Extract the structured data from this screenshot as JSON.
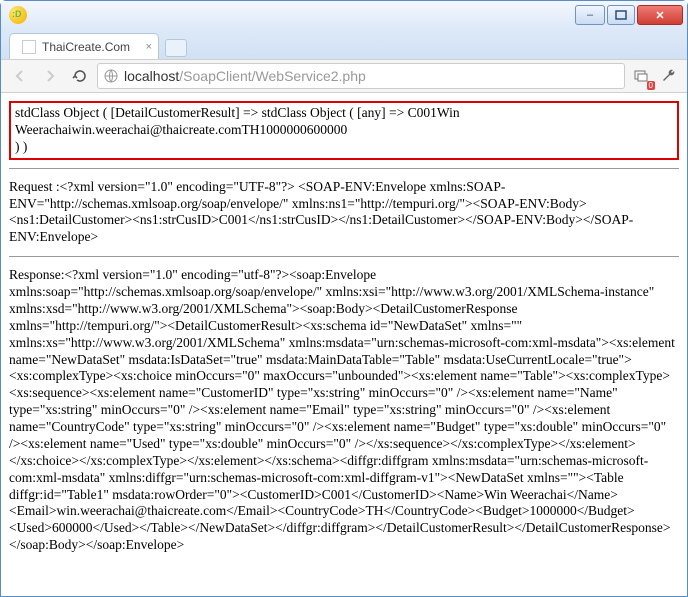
{
  "window": {
    "minimize": "–",
    "maximize": "▢",
    "close": "✕"
  },
  "tab": {
    "title": "ThaiCreate.Com",
    "close": "×"
  },
  "toolbar": {
    "back": "←",
    "forward": "→",
    "reload": "⟳",
    "host": "localhost",
    "path": "/SoapClient/WebService2.php",
    "popup_badge": "0",
    "wrench": "wrench"
  },
  "page": {
    "box_line1": "stdClass Object ( [DetailCustomerResult] => stdClass Object ( [any] => C001Win",
    "box_line2": "Weerachaiwin.weerachai@thaicreate.comTH1000000600000",
    "box_line3": ") )",
    "request": "Request :<?xml version=\"1.0\" encoding=\"UTF-8\"?> <SOAP-ENV:Envelope xmlns:SOAP-ENV=\"http://schemas.xmlsoap.org/soap/envelope/\" xmlns:ns1=\"http://tempuri.org/\"><SOAP-ENV:Body><ns1:DetailCustomer><ns1:strCusID>C001</ns1:strCusID></ns1:DetailCustomer></SOAP-ENV:Body></SOAP-ENV:Envelope>",
    "response": "Response:<?xml version=\"1.0\" encoding=\"utf-8\"?><soap:Envelope xmlns:soap=\"http://schemas.xmlsoap.org/soap/envelope/\" xmlns:xsi=\"http://www.w3.org/2001/XMLSchema-instance\" xmlns:xsd=\"http://www.w3.org/2001/XMLSchema\"><soap:Body><DetailCustomerResponse xmlns=\"http://tempuri.org/\"><DetailCustomerResult><xs:schema id=\"NewDataSet\" xmlns=\"\" xmlns:xs=\"http://www.w3.org/2001/XMLSchema\" xmlns:msdata=\"urn:schemas-microsoft-com:xml-msdata\"><xs:element name=\"NewDataSet\" msdata:IsDataSet=\"true\" msdata:MainDataTable=\"Table\" msdata:UseCurrentLocale=\"true\"><xs:complexType><xs:choice minOccurs=\"0\" maxOccurs=\"unbounded\"><xs:element name=\"Table\"><xs:complexType><xs:sequence><xs:element name=\"CustomerID\" type=\"xs:string\" minOccurs=\"0\" /><xs:element name=\"Name\" type=\"xs:string\" minOccurs=\"0\" /><xs:element name=\"Email\" type=\"xs:string\" minOccurs=\"0\" /><xs:element name=\"CountryCode\" type=\"xs:string\" minOccurs=\"0\" /><xs:element name=\"Budget\" type=\"xs:double\" minOccurs=\"0\" /><xs:element name=\"Used\" type=\"xs:double\" minOccurs=\"0\" /></xs:sequence></xs:complexType></xs:element></xs:choice></xs:complexType></xs:element></xs:schema><diffgr:diffgram xmlns:msdata=\"urn:schemas-microsoft-com:xml-msdata\" xmlns:diffgr=\"urn:schemas-microsoft-com:xml-diffgram-v1\"><NewDataSet xmlns=\"\"><Table diffgr:id=\"Table1\" msdata:rowOrder=\"0\"><CustomerID>C001</CustomerID><Name>Win Weerachai</Name><Email>win.weerachai@thaicreate.com</Email><CountryCode>TH</CountryCode><Budget>1000000</Budget><Used>600000</Used></Table></NewDataSet></diffgr:diffgram></DetailCustomerResult></DetailCustomerResponse></soap:Body></soap:Envelope>"
  }
}
